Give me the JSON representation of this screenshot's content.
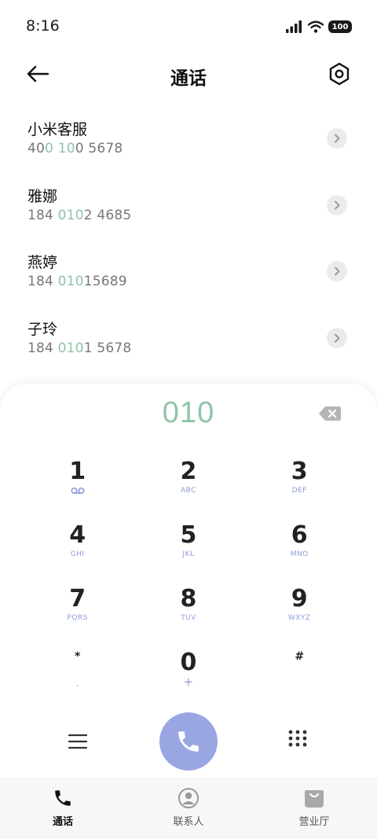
{
  "status_bar": {
    "time": "8:16",
    "battery": "100"
  },
  "header": {
    "title": "通话",
    "back_icon": "arrow-left-icon",
    "settings_icon": "hexagon-settings-icon"
  },
  "contacts": [
    {
      "name": "小米客服",
      "number_parts": [
        "40",
        "0",
        " ",
        "10",
        "0 5678"
      ]
    },
    {
      "name": "雅娜",
      "number_parts": [
        "184 ",
        "010",
        "2 4685"
      ]
    },
    {
      "name": "燕婷",
      "number_parts": [
        "184 ",
        "010",
        "15689"
      ]
    },
    {
      "name": "子玲",
      "number_parts": [
        "184 ",
        "010",
        "1 5678"
      ]
    }
  ],
  "dialer": {
    "dialed_number": "010",
    "keys": [
      [
        {
          "digit": "1",
          "sub": "voicemail-icon"
        },
        {
          "digit": "2",
          "sub": "ABC"
        },
        {
          "digit": "3",
          "sub": "DEF"
        }
      ],
      [
        {
          "digit": "4",
          "sub": "GHI"
        },
        {
          "digit": "5",
          "sub": "JKL"
        },
        {
          "digit": "6",
          "sub": "MNO"
        }
      ],
      [
        {
          "digit": "7",
          "sub": "PQRS"
        },
        {
          "digit": "8",
          "sub": "TUV"
        },
        {
          "digit": "9",
          "sub": "WXYZ"
        }
      ],
      [
        {
          "digit": "*",
          "sub": ","
        },
        {
          "digit": "0",
          "sub": "+"
        },
        {
          "digit": "#",
          "sub": ""
        }
      ]
    ]
  },
  "colors": {
    "accent_green": "#8fc3a7",
    "accent_blue": "#9aa6e2",
    "letters_blue": "#8f9ad6"
  },
  "bottom_nav": [
    {
      "label": "通话",
      "icon": "phone-icon",
      "active": true
    },
    {
      "label": "联系人",
      "icon": "person-icon",
      "active": false
    },
    {
      "label": "营业厅",
      "icon": "bag-icon",
      "active": false
    }
  ]
}
